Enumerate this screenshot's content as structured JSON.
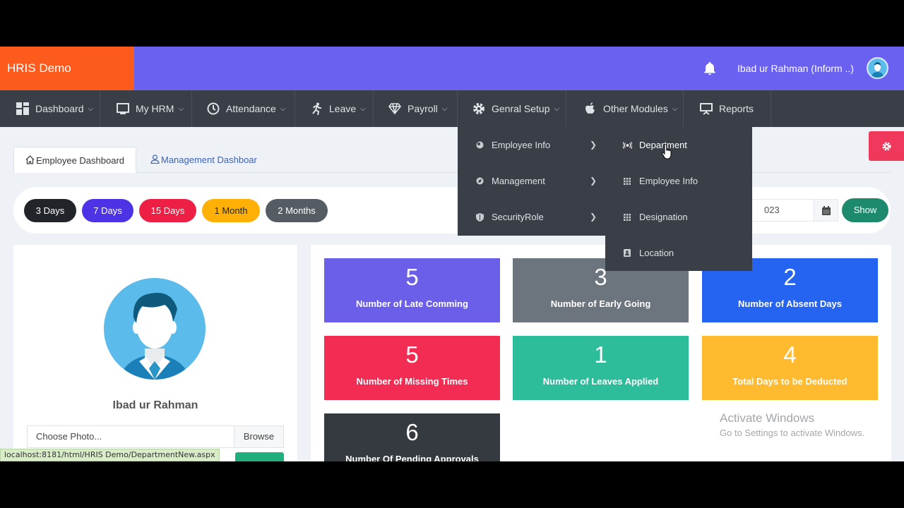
{
  "header": {
    "brand": "HRIS Demo",
    "user_name": "Ibad ur Rahman (Inform ..)",
    "bell_icon": "bell-icon",
    "colors": {
      "brand_bg": "#fd5a1e",
      "topbar_bg": "#6a61f1",
      "nav_bg": "#3a3f47"
    }
  },
  "nav": {
    "items": [
      {
        "label": "Dashboard",
        "icon": "grid-icon"
      },
      {
        "label": "My HRM",
        "icon": "monitor-icon"
      },
      {
        "label": "Attendance",
        "icon": "clock-icon"
      },
      {
        "label": "Leave",
        "icon": "running-icon"
      },
      {
        "label": "Payroll",
        "icon": "diamond-icon"
      },
      {
        "label": "Genral Setup",
        "icon": "gear-icon"
      },
      {
        "label": "Other Modules",
        "icon": "apple-icon"
      },
      {
        "label": "Reports",
        "icon": "presentation-icon"
      }
    ]
  },
  "general_setup_menu": {
    "items": [
      {
        "label": "Employee Info",
        "icon": "circle-icon"
      },
      {
        "label": "Management",
        "icon": "compass-icon"
      },
      {
        "label": "SecurityRole",
        "icon": "shield-icon"
      }
    ]
  },
  "employee_info_submenu": {
    "items": [
      {
        "label": "Department",
        "icon": "broadcast-icon"
      },
      {
        "label": "Employee Info",
        "icon": "grid-small-icon"
      },
      {
        "label": "Designation",
        "icon": "grid-small-icon"
      },
      {
        "label": "Location",
        "icon": "id-card-icon"
      }
    ]
  },
  "tabs": {
    "employee": "Employee Dashboard",
    "management": "Management Dashboar"
  },
  "filters": {
    "ranges": [
      {
        "label": "3 Days",
        "color": "#212529"
      },
      {
        "label": "7 Days",
        "color": "#4c34e6"
      },
      {
        "label": "15 Days",
        "color": "#ee1f45"
      },
      {
        "label": "1 Month",
        "color": "#ffb007"
      },
      {
        "label": "2 Months",
        "color": "#565c63"
      }
    ],
    "date_value": "023",
    "show_label": "Show"
  },
  "profile": {
    "name": "Ibad ur Rahman",
    "file_placeholder": "Choose Photo...",
    "browse_label": "Browse"
  },
  "stats": [
    {
      "value": "5",
      "label": "Number of Late Comming",
      "color": "#6b5ee8"
    },
    {
      "value": "3",
      "label": "Number of Early Going",
      "color": "#6c757d"
    },
    {
      "value": "2",
      "label": "Number of Absent Days",
      "color": "#2563f1"
    },
    {
      "value": "5",
      "label": "Number of Missing Times",
      "color": "#f22c52"
    },
    {
      "value": "1",
      "label": "Number of Leaves Applied",
      "color": "#2ebd9a"
    },
    {
      "value": "4",
      "label": "Total Days to be Deducted",
      "color": "#ffba2f"
    },
    {
      "value": "6",
      "label": "Number Of Pending Approvals",
      "color": "#353a40"
    }
  ],
  "watermark": {
    "line1": "Activate Windows",
    "line2": "Go to Settings to activate Windows."
  },
  "status_url": "localhost:8181/html/HRIS Demo/DepartmentNew.aspx"
}
